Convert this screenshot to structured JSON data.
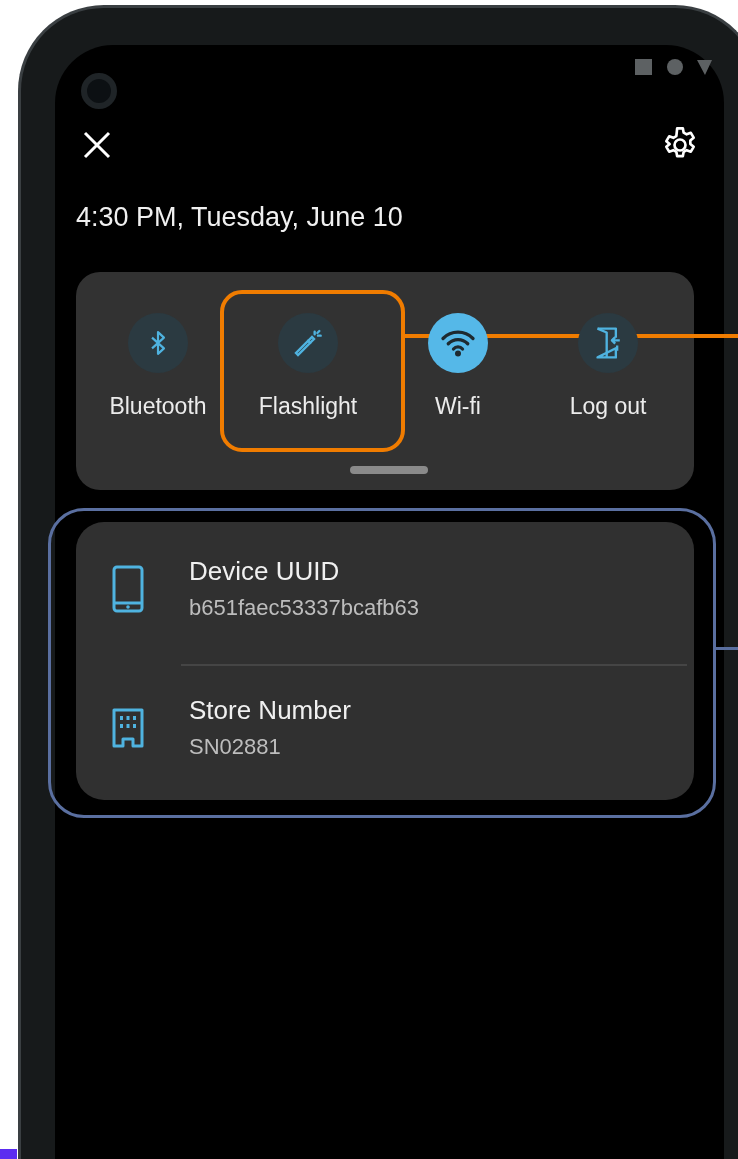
{
  "header": {
    "datetime": "4:30 PM, Tuesday, June 10"
  },
  "quick_settings": [
    {
      "kind": "bluetooth",
      "label": "Bluetooth",
      "on": false,
      "callout": false
    },
    {
      "kind": "flashlight",
      "label": "Flashlight",
      "on": false,
      "callout": true
    },
    {
      "kind": "wifi",
      "label": "Wi-fi",
      "on": true,
      "callout": false
    },
    {
      "kind": "logout",
      "label": "Log out",
      "on": false,
      "callout": false
    }
  ],
  "info_card": {
    "callout": true,
    "rows": [
      {
        "kind": "tablet",
        "title": "Device UUID",
        "value": "b651faec53337bcafb63"
      },
      {
        "kind": "building",
        "title": "Store Number",
        "value": "SN02881"
      }
    ]
  }
}
